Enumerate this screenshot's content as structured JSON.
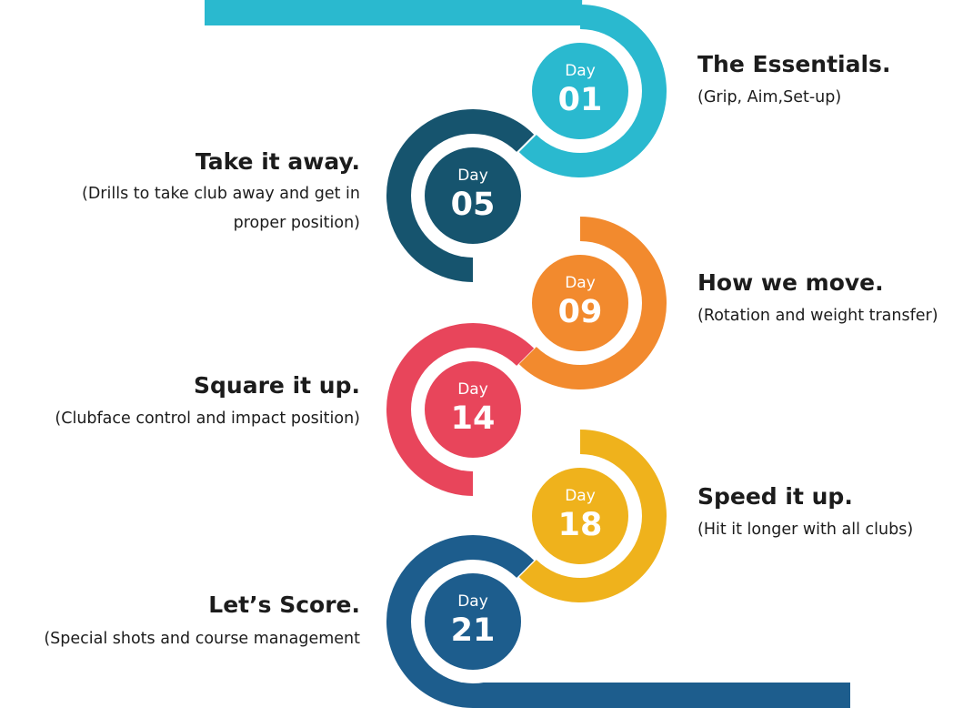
{
  "colors": {
    "teal": "#2ab9cf",
    "navy": "#16546e",
    "orange": "#f28a2e",
    "red": "#e8455b",
    "yellow": "#efb21c",
    "blue": "#1d5d8d"
  },
  "stages": [
    {
      "day_label": "Day",
      "day_number": "01",
      "title": "The Essentials.",
      "description": "(Grip, Aim,Set-up)"
    },
    {
      "day_label": "Day",
      "day_number": "05",
      "title": "Take it away.",
      "description": "(Drills to take club away and get in proper position)"
    },
    {
      "day_label": "Day",
      "day_number": "09",
      "title": "How we move.",
      "description": "(Rotation and weight transfer)"
    },
    {
      "day_label": "Day",
      "day_number": "14",
      "title": "Square it up.",
      "description": "(Clubface control and impact position)"
    },
    {
      "day_label": "Day",
      "day_number": "18",
      "title": "Speed it up.",
      "description": "(Hit it longer with all clubs)"
    },
    {
      "day_label": "Day",
      "day_number": "21",
      "title": "Let’s Score.",
      "description": "(Special shots and course management"
    }
  ]
}
